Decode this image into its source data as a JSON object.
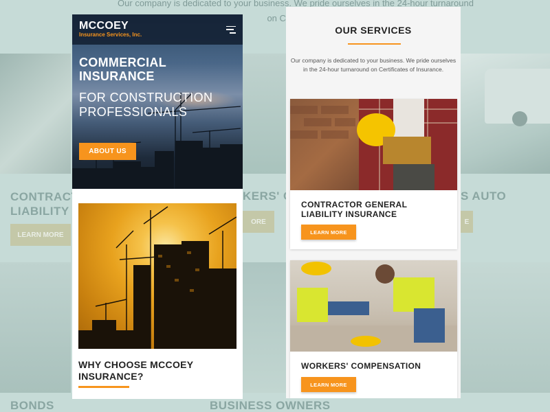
{
  "background": {
    "top_text_line1": "Our company is dedicated to your business. We pride ourselves in the 24-hour turnaround",
    "top_text_line2": "on Certificates",
    "heading_contractor": "CONTRACTOR",
    "heading_contractor_2": "LIABILITY IN",
    "heading_workers": "KERS' CO",
    "heading_auto": "S AUTO",
    "learn_more": "LEARN MORE",
    "learn_more_mid": "ORE",
    "learn_more_right": "E",
    "heading_bonds": "BONDS",
    "heading_business_owners": "BUSINESS OWNERS"
  },
  "left_phone": {
    "logo_main": "MCCOEY",
    "logo_sub": "Insurance Services, Inc.",
    "hero_title_line1": "COMMERCIAL",
    "hero_title_line2": "INSURANCE",
    "hero_subtitle_line1": "FOR CONSTRUCTION",
    "hero_subtitle_line2": "PROFESSIONALS",
    "about_button": "ABOUT US",
    "why_line1": "WHY CHOOSE MCCOEY",
    "why_line2": "INSURANCE?"
  },
  "right_phone": {
    "services_title": "OUR SERVICES",
    "services_desc": "Our company is dedicated to your business. We pride ourselves in the 24-hour turnaround on Certificates of Insurance.",
    "card1_title_line1": "CONTRACTOR GENERAL",
    "card1_title_line2": "LIABILITY INSURANCE",
    "card1_button": "LEARN MORE",
    "card2_title": "WORKERS' COMPENSATION",
    "card2_button": "LEARN MORE"
  },
  "colors": {
    "accent": "#f7941d",
    "navy": "#142134",
    "background": "#c6dbd7"
  }
}
